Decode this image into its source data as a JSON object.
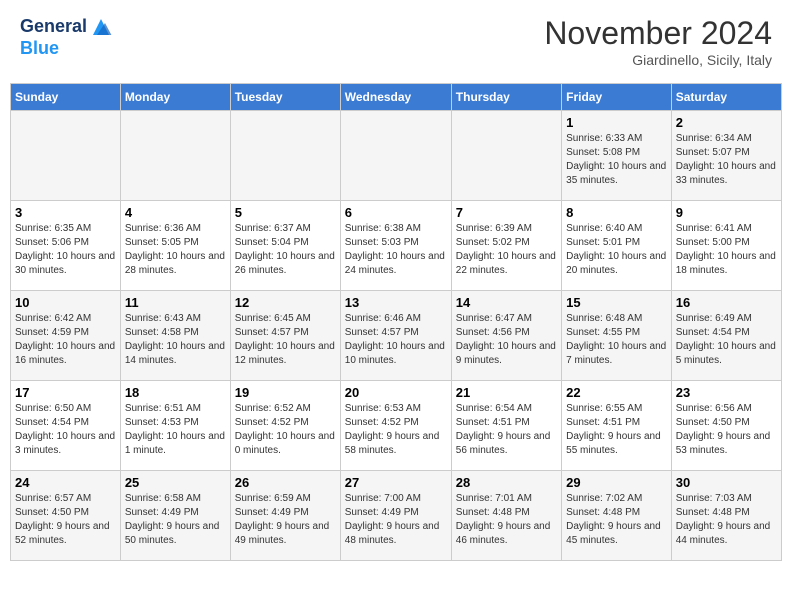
{
  "header": {
    "logo_line1": "General",
    "logo_line2": "Blue",
    "month_title": "November 2024",
    "location": "Giardinello, Sicily, Italy"
  },
  "weekdays": [
    "Sunday",
    "Monday",
    "Tuesday",
    "Wednesday",
    "Thursday",
    "Friday",
    "Saturday"
  ],
  "weeks": [
    [
      {
        "day": "",
        "sunrise": "",
        "sunset": "",
        "daylight": ""
      },
      {
        "day": "",
        "sunrise": "",
        "sunset": "",
        "daylight": ""
      },
      {
        "day": "",
        "sunrise": "",
        "sunset": "",
        "daylight": ""
      },
      {
        "day": "",
        "sunrise": "",
        "sunset": "",
        "daylight": ""
      },
      {
        "day": "",
        "sunrise": "",
        "sunset": "",
        "daylight": ""
      },
      {
        "day": "1",
        "sunrise": "Sunrise: 6:33 AM",
        "sunset": "Sunset: 5:08 PM",
        "daylight": "Daylight: 10 hours and 35 minutes."
      },
      {
        "day": "2",
        "sunrise": "Sunrise: 6:34 AM",
        "sunset": "Sunset: 5:07 PM",
        "daylight": "Daylight: 10 hours and 33 minutes."
      }
    ],
    [
      {
        "day": "3",
        "sunrise": "Sunrise: 6:35 AM",
        "sunset": "Sunset: 5:06 PM",
        "daylight": "Daylight: 10 hours and 30 minutes."
      },
      {
        "day": "4",
        "sunrise": "Sunrise: 6:36 AM",
        "sunset": "Sunset: 5:05 PM",
        "daylight": "Daylight: 10 hours and 28 minutes."
      },
      {
        "day": "5",
        "sunrise": "Sunrise: 6:37 AM",
        "sunset": "Sunset: 5:04 PM",
        "daylight": "Daylight: 10 hours and 26 minutes."
      },
      {
        "day": "6",
        "sunrise": "Sunrise: 6:38 AM",
        "sunset": "Sunset: 5:03 PM",
        "daylight": "Daylight: 10 hours and 24 minutes."
      },
      {
        "day": "7",
        "sunrise": "Sunrise: 6:39 AM",
        "sunset": "Sunset: 5:02 PM",
        "daylight": "Daylight: 10 hours and 22 minutes."
      },
      {
        "day": "8",
        "sunrise": "Sunrise: 6:40 AM",
        "sunset": "Sunset: 5:01 PM",
        "daylight": "Daylight: 10 hours and 20 minutes."
      },
      {
        "day": "9",
        "sunrise": "Sunrise: 6:41 AM",
        "sunset": "Sunset: 5:00 PM",
        "daylight": "Daylight: 10 hours and 18 minutes."
      }
    ],
    [
      {
        "day": "10",
        "sunrise": "Sunrise: 6:42 AM",
        "sunset": "Sunset: 4:59 PM",
        "daylight": "Daylight: 10 hours and 16 minutes."
      },
      {
        "day": "11",
        "sunrise": "Sunrise: 6:43 AM",
        "sunset": "Sunset: 4:58 PM",
        "daylight": "Daylight: 10 hours and 14 minutes."
      },
      {
        "day": "12",
        "sunrise": "Sunrise: 6:45 AM",
        "sunset": "Sunset: 4:57 PM",
        "daylight": "Daylight: 10 hours and 12 minutes."
      },
      {
        "day": "13",
        "sunrise": "Sunrise: 6:46 AM",
        "sunset": "Sunset: 4:57 PM",
        "daylight": "Daylight: 10 hours and 10 minutes."
      },
      {
        "day": "14",
        "sunrise": "Sunrise: 6:47 AM",
        "sunset": "Sunset: 4:56 PM",
        "daylight": "Daylight: 10 hours and 9 minutes."
      },
      {
        "day": "15",
        "sunrise": "Sunrise: 6:48 AM",
        "sunset": "Sunset: 4:55 PM",
        "daylight": "Daylight: 10 hours and 7 minutes."
      },
      {
        "day": "16",
        "sunrise": "Sunrise: 6:49 AM",
        "sunset": "Sunset: 4:54 PM",
        "daylight": "Daylight: 10 hours and 5 minutes."
      }
    ],
    [
      {
        "day": "17",
        "sunrise": "Sunrise: 6:50 AM",
        "sunset": "Sunset: 4:54 PM",
        "daylight": "Daylight: 10 hours and 3 minutes."
      },
      {
        "day": "18",
        "sunrise": "Sunrise: 6:51 AM",
        "sunset": "Sunset: 4:53 PM",
        "daylight": "Daylight: 10 hours and 1 minute."
      },
      {
        "day": "19",
        "sunrise": "Sunrise: 6:52 AM",
        "sunset": "Sunset: 4:52 PM",
        "daylight": "Daylight: 10 hours and 0 minutes."
      },
      {
        "day": "20",
        "sunrise": "Sunrise: 6:53 AM",
        "sunset": "Sunset: 4:52 PM",
        "daylight": "Daylight: 9 hours and 58 minutes."
      },
      {
        "day": "21",
        "sunrise": "Sunrise: 6:54 AM",
        "sunset": "Sunset: 4:51 PM",
        "daylight": "Daylight: 9 hours and 56 minutes."
      },
      {
        "day": "22",
        "sunrise": "Sunrise: 6:55 AM",
        "sunset": "Sunset: 4:51 PM",
        "daylight": "Daylight: 9 hours and 55 minutes."
      },
      {
        "day": "23",
        "sunrise": "Sunrise: 6:56 AM",
        "sunset": "Sunset: 4:50 PM",
        "daylight": "Daylight: 9 hours and 53 minutes."
      }
    ],
    [
      {
        "day": "24",
        "sunrise": "Sunrise: 6:57 AM",
        "sunset": "Sunset: 4:50 PM",
        "daylight": "Daylight: 9 hours and 52 minutes."
      },
      {
        "day": "25",
        "sunrise": "Sunrise: 6:58 AM",
        "sunset": "Sunset: 4:49 PM",
        "daylight": "Daylight: 9 hours and 50 minutes."
      },
      {
        "day": "26",
        "sunrise": "Sunrise: 6:59 AM",
        "sunset": "Sunset: 4:49 PM",
        "daylight": "Daylight: 9 hours and 49 minutes."
      },
      {
        "day": "27",
        "sunrise": "Sunrise: 7:00 AM",
        "sunset": "Sunset: 4:49 PM",
        "daylight": "Daylight: 9 hours and 48 minutes."
      },
      {
        "day": "28",
        "sunrise": "Sunrise: 7:01 AM",
        "sunset": "Sunset: 4:48 PM",
        "daylight": "Daylight: 9 hours and 46 minutes."
      },
      {
        "day": "29",
        "sunrise": "Sunrise: 7:02 AM",
        "sunset": "Sunset: 4:48 PM",
        "daylight": "Daylight: 9 hours and 45 minutes."
      },
      {
        "day": "30",
        "sunrise": "Sunrise: 7:03 AM",
        "sunset": "Sunset: 4:48 PM",
        "daylight": "Daylight: 9 hours and 44 minutes."
      }
    ]
  ]
}
